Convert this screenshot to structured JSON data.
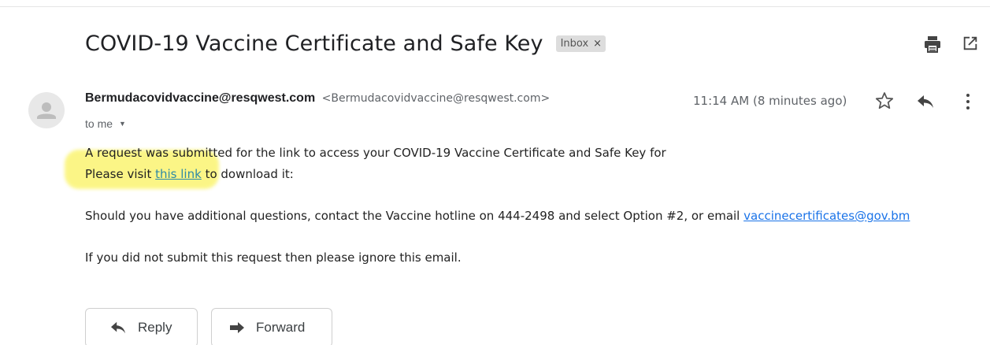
{
  "email": {
    "subject": "COVID-19 Vaccine Certificate and Safe Key",
    "label": "Inbox",
    "label_close": "×",
    "sender_name": "Bermudacovidvaccine@resqwest.com",
    "sender_email": "<Bermudacovidvaccine@resqwest.com>",
    "recipient": "to me",
    "timestamp": "11:14 AM (8 minutes ago)",
    "body": {
      "line1": "A request was submitted for the link to access your COVID-19 Vaccine Certificate and Safe Key for",
      "line2_prefix": "Please visit ",
      "line2_link": "this link",
      "line2_suffix": " to download it:",
      "line3_prefix": "Should you have additional questions, contact the Vaccine hotline on 444-2498 and select Option #2, or email ",
      "line3_link": "vaccinecertificates@gov.bm",
      "line4": "If you did not submit this request then please ignore this email."
    }
  },
  "actions": {
    "reply_label": "Reply",
    "forward_label": "Forward"
  },
  "icons": {
    "print": "print-icon",
    "new_window": "open-in-new-window-icon",
    "star": "star-icon",
    "reply": "reply-icon",
    "more": "more-vertical-icon",
    "avatar": "person-avatar-icon",
    "caret": "chevron-down-icon",
    "forward": "forward-icon"
  },
  "colors": {
    "highlight": "#fbf57a",
    "link": "#1a73e8",
    "chip_bg": "#dddddd"
  }
}
